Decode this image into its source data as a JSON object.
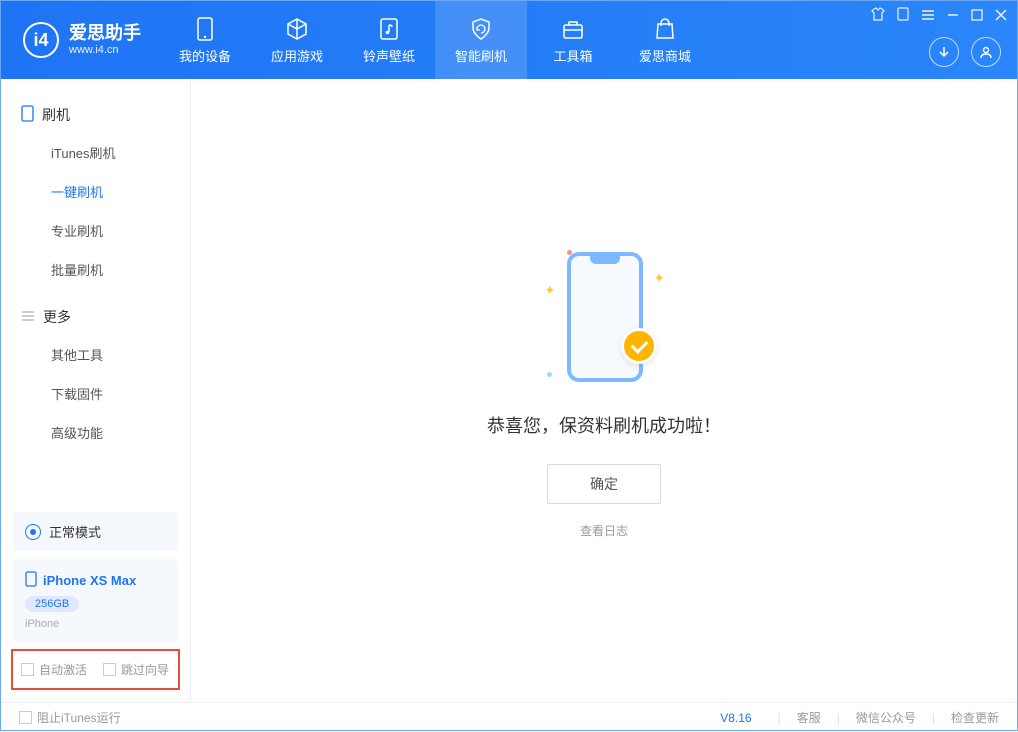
{
  "header": {
    "logo_title": "爱思助手",
    "logo_sub": "www.i4.cn",
    "tabs": [
      "我的设备",
      "应用游戏",
      "铃声壁纸",
      "智能刷机",
      "工具箱",
      "爱思商城"
    ]
  },
  "sidebar": {
    "group1_title": "刷机",
    "group1_items": [
      "iTunes刷机",
      "一键刷机",
      "专业刷机",
      "批量刷机"
    ],
    "group2_title": "更多",
    "group2_items": [
      "其他工具",
      "下载固件",
      "高级功能"
    ],
    "mode_label": "正常模式",
    "device_name": "iPhone XS Max",
    "device_capacity": "256GB",
    "device_type": "iPhone",
    "opt_auto_activate": "自动激活",
    "opt_skip_guide": "跳过向导"
  },
  "main": {
    "success_msg": "恭喜您，保资料刷机成功啦！",
    "confirm_btn": "确定",
    "view_log": "查看日志"
  },
  "statusbar": {
    "block_itunes": "阻止iTunes运行",
    "version": "V8.16",
    "support": "客服",
    "wechat": "微信公众号",
    "check_update": "检查更新"
  }
}
